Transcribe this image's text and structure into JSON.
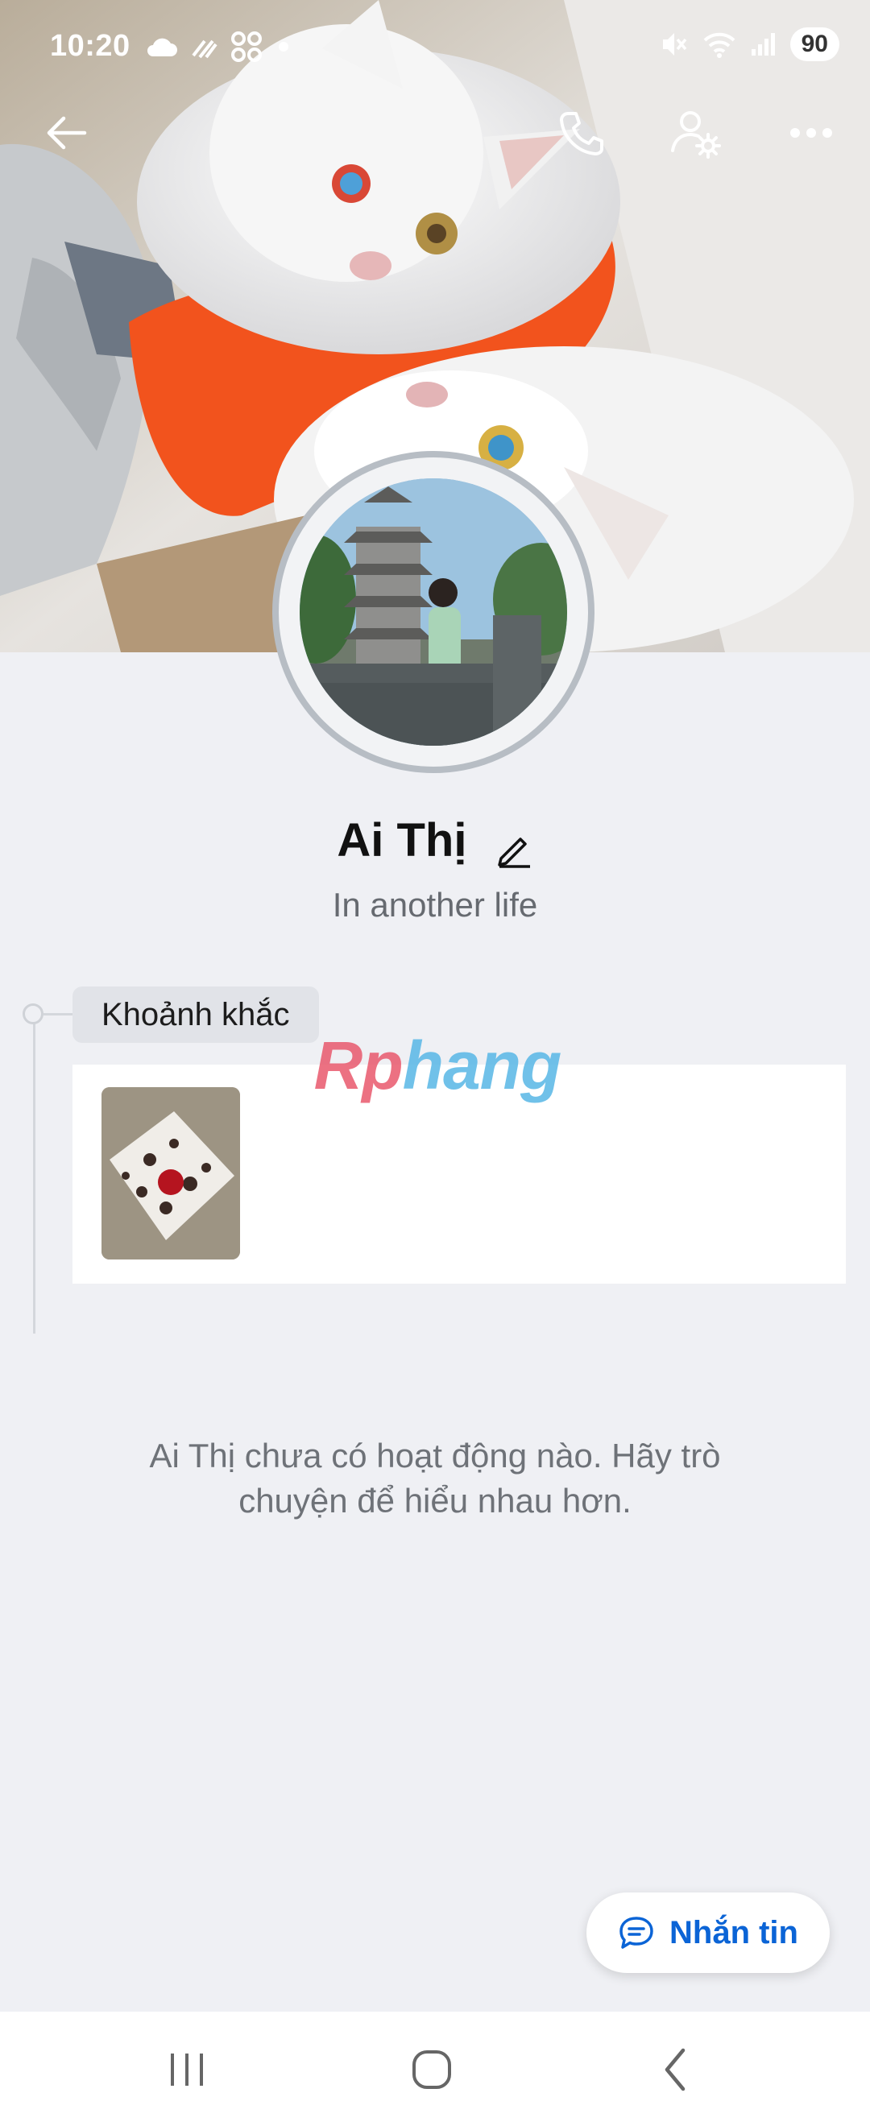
{
  "status_bar": {
    "time": "10:20",
    "battery": "90",
    "icons": [
      "cloud-icon",
      "link-icon",
      "app-grid-icon",
      "dot-icon",
      "mute-icon",
      "wifi-icon",
      "signal-icon"
    ]
  },
  "header": {
    "icons": [
      "back-arrow-icon",
      "phone-icon",
      "profile-settings-icon",
      "more-icon"
    ]
  },
  "profile": {
    "name": "Ai Thị",
    "bio": "In another life"
  },
  "moments": {
    "tag_label": "Khoảnh khắc"
  },
  "watermark": {
    "part1": "Rp",
    "part2": "hang"
  },
  "empty_state": {
    "text": "Ai Thị chưa có hoạt động nào. Hãy trò chuyện để hiểu nhau hơn."
  },
  "chat_button": {
    "label": "Nhắn tin"
  },
  "nav": {
    "icons": [
      "recent-apps-icon",
      "home-icon",
      "back-icon"
    ]
  },
  "colors": {
    "accent": "#0b64d6",
    "background": "#eff0f4"
  }
}
